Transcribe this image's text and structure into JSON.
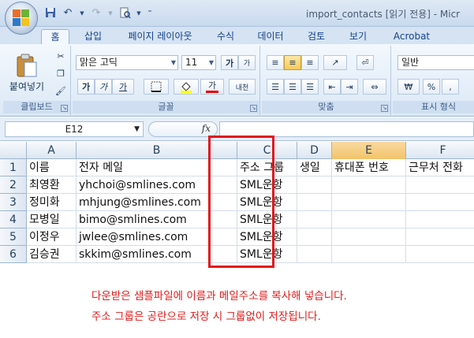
{
  "window": {
    "title": "import_contacts  [읽기 전용] - Micr"
  },
  "quick_access": {
    "save_icon": "save-icon",
    "undo_icon": "undo-icon",
    "redo_icon": "redo-icon",
    "print_preview_icon": "print-preview-icon",
    "customize_icon": "chevron-down-icon"
  },
  "tabs": [
    "홈",
    "삽입",
    "페이지 레이아웃",
    "수식",
    "데이터",
    "검토",
    "보기",
    "Acrobat"
  ],
  "ribbon": {
    "clipboard": {
      "paste_label": "붙여넣기",
      "group_label": "클립보드"
    },
    "font": {
      "font_name": "맑은 고딕",
      "font_size": "11",
      "grow_label": "가",
      "shrink_label": "가",
      "bold_label": "가",
      "italic_label": "가",
      "underline_label": "가",
      "font_color_label": "가",
      "phonetic_label": "내천",
      "group_label": "글꼴"
    },
    "alignment": {
      "group_label": "맞춤"
    },
    "number": {
      "format": "일반",
      "currency": "₩",
      "percent": "%",
      "comma": ",",
      "group_label": "표시 형식"
    }
  },
  "formula_bar": {
    "name_box": "E12",
    "fx_label": "fx",
    "value": ""
  },
  "sheet": {
    "columns": [
      "A",
      "B",
      "C",
      "D",
      "E",
      "F"
    ],
    "active_column": "E",
    "rows": [
      "1",
      "2",
      "3",
      "4",
      "5",
      "6"
    ],
    "cells": [
      [
        "이름",
        "전자 메일",
        "주소 그룹",
        "생일",
        "휴대폰 번호",
        "근무처 전화"
      ],
      [
        "최영환",
        "yhchoi@smlines.com",
        "SML운항",
        "",
        "",
        ""
      ],
      [
        "정미화",
        "mhjung@smlines.com",
        "SML운항",
        "",
        "",
        ""
      ],
      [
        "모병일",
        "bimo@smlines.com",
        "SML운항",
        "",
        "",
        ""
      ],
      [
        "이정우",
        "jwlee@smlines.com",
        "SML운항",
        "",
        "",
        ""
      ],
      [
        "김승권",
        "skkim@smlines.com",
        "SML운항",
        "",
        "",
        ""
      ]
    ]
  },
  "annotation": {
    "line1": "다운받은 샘플파일에 이름과 메일주소를 복사해 넣습니다.",
    "line2": "주소 그룹은 공란으로 저장 시 그룹없이 저장됩니다.",
    "color": "#e31b1b"
  }
}
